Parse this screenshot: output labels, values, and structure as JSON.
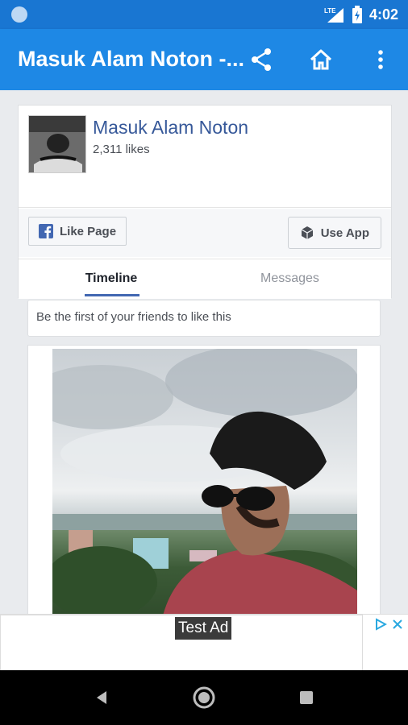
{
  "status": {
    "time": "4:02",
    "network": "LTE"
  },
  "app_bar": {
    "title": "Masuk Alam Noton -...",
    "icons": [
      "share-icon",
      "home-icon",
      "more-vert-icon"
    ]
  },
  "page": {
    "name": "Masuk Alam Noton",
    "likes": "2,311 likes"
  },
  "buttons": {
    "like_page": "Like Page",
    "use_app": "Use App"
  },
  "tabs": {
    "timeline": "Timeline",
    "messages": "Messages"
  },
  "friends_notice": "Be the first of your friends to like this",
  "ad": {
    "label": "Test Ad",
    "icons": [
      "adchoices-icon",
      "close-icon"
    ]
  },
  "colors": {
    "status_bar": "#1976d2",
    "app_bar": "#1e88e5",
    "fb_blue": "#365899"
  }
}
